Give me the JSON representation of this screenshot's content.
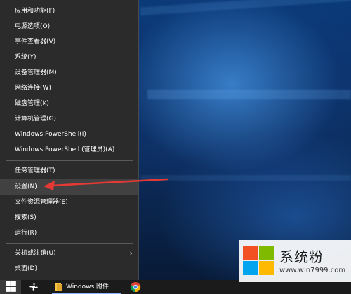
{
  "menu": {
    "items": [
      {
        "label": "应用和功能(F)"
      },
      {
        "label": "电源选项(O)"
      },
      {
        "label": "事件查看器(V)"
      },
      {
        "label": "系统(Y)"
      },
      {
        "label": "设备管理器(M)"
      },
      {
        "label": "网络连接(W)"
      },
      {
        "label": "磁盘管理(K)"
      },
      {
        "label": "计算机管理(G)"
      },
      {
        "label": "Windows PowerShell(I)"
      },
      {
        "label": "Windows PowerShell (管理员)(A)"
      },
      {
        "label": "任务管理器(T)"
      },
      {
        "label": "设置(N)"
      },
      {
        "label": "文件资源管理器(E)"
      },
      {
        "label": "搜索(S)"
      },
      {
        "label": "运行(R)"
      },
      {
        "label": "关机或注销(U)",
        "submenu_icon": "chevron-right-icon"
      },
      {
        "label": "桌面(D)"
      }
    ],
    "highlighted": "设置(N)"
  },
  "taskbar": {
    "window_label": "Windows 附件",
    "icons": [
      "windows-logo-icon",
      "fan-app-icon",
      "folder-icon",
      "chrome-icon"
    ]
  },
  "watermark": {
    "brand": "系统粉",
    "url": "www.win7999.com"
  },
  "colors": {
    "menu_bg": "#2b2b2b",
    "highlight": "#414141",
    "arrow": "#e53935",
    "taskbar_bg": "#1b1b1b"
  }
}
